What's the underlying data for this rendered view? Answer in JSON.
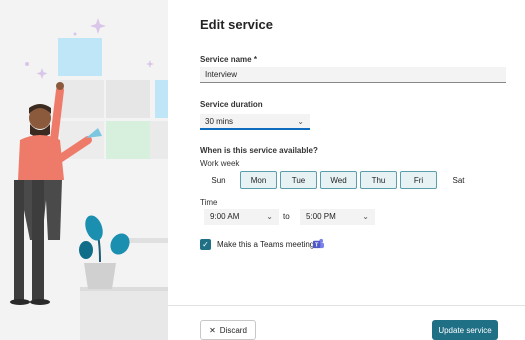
{
  "panel": {
    "title": "Edit service",
    "service_name_label": "Service name *",
    "service_name_value": "Interview",
    "duration_label": "Service duration",
    "duration_value": "30 mins",
    "availability_label": "When is this service available?",
    "work_week_label": "Work week",
    "days": [
      {
        "label": "Sun",
        "selected": false
      },
      {
        "label": "Mon",
        "selected": true
      },
      {
        "label": "Tue",
        "selected": true
      },
      {
        "label": "Wed",
        "selected": true
      },
      {
        "label": "Thu",
        "selected": true
      },
      {
        "label": "Fri",
        "selected": true
      },
      {
        "label": "Sat",
        "selected": false
      }
    ],
    "time_label": "Time",
    "start_time": "9:00 AM",
    "to_label": "to",
    "end_time": "5:00 PM",
    "teams_checkbox_label": "Make this a Teams meeting",
    "teams_checked": true,
    "discard_label": "Discard",
    "update_label": "Update service"
  },
  "colors": {
    "accent": "#1f6f85",
    "selected_day_bg": "#e6f2f4",
    "focus_underline": "#0f6cbd"
  },
  "icons": {
    "chevron": "chevron-down-icon",
    "discard": "close-icon",
    "checkbox": "checkmark-icon",
    "teams": "teams-icon"
  }
}
